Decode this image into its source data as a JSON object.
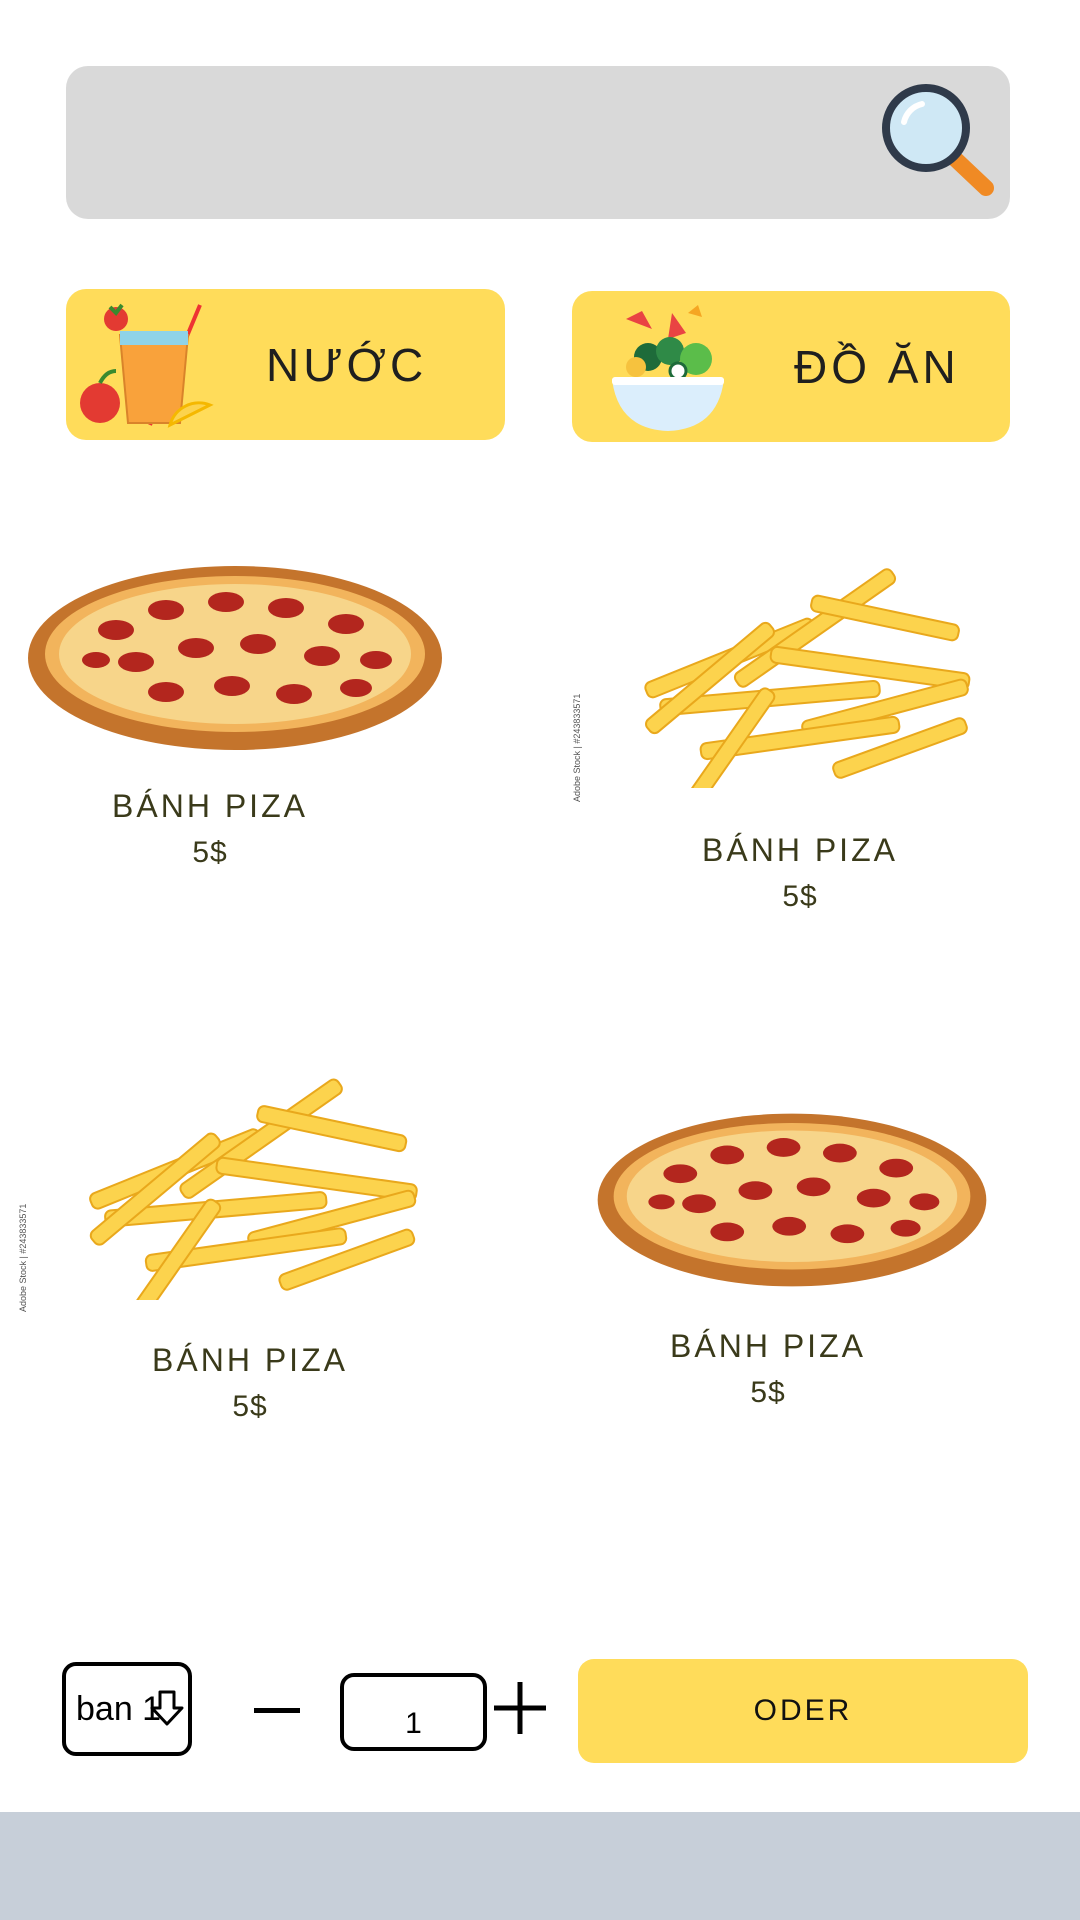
{
  "search": {
    "icon": "search-icon",
    "colors": {
      "bar": "#d9d9d9",
      "lens": "#cfe8f5",
      "handle": "#f08a24",
      "frame": "#2f3a4a"
    }
  },
  "categories": [
    {
      "label": "NƯỚC",
      "icon": "juice-icon"
    },
    {
      "label": "ĐỒ ĂN",
      "icon": "salad-icon"
    }
  ],
  "products": [
    {
      "name": "BÁNH PIZA",
      "price": "5$",
      "image": "pizza-image"
    },
    {
      "name": "BÁNH PIZA",
      "price": "5$",
      "image": "fries-image",
      "watermark": "Adobe Stock | #243833571"
    },
    {
      "name": "BÁNH PIZA",
      "price": "5$",
      "image": "fries-image",
      "watermark": "Adobe Stock | #243833571"
    },
    {
      "name": "BÁNH PIZA",
      "price": "5$",
      "image": "pizza-image"
    }
  ],
  "order": {
    "table_select_value": "ban 1",
    "quantity": "1",
    "order_label": "ODER"
  },
  "colors": {
    "accent_yellow": "#ffdc5a",
    "text_dark": "#3a3a1a",
    "bottom_bar": "#c7cfd9"
  }
}
